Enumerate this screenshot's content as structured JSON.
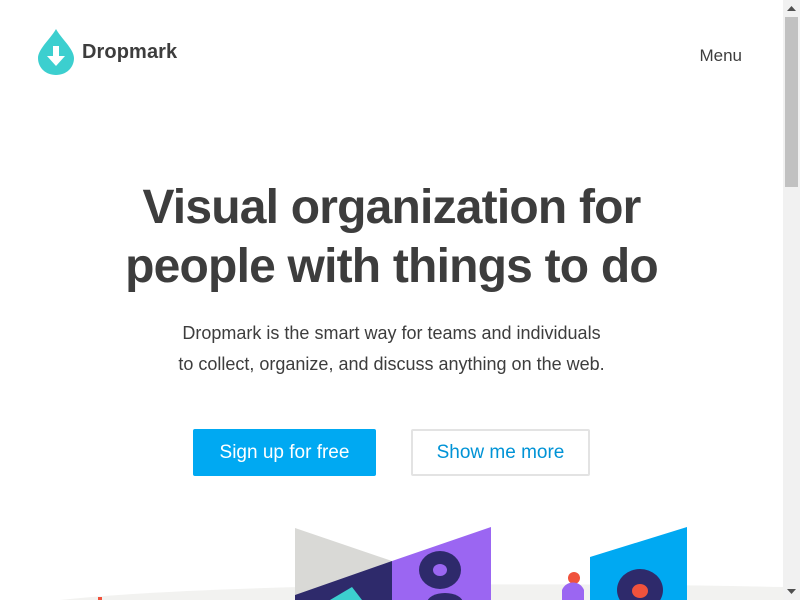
{
  "header": {
    "brand": "Dropmark",
    "menu_label": "Menu"
  },
  "hero": {
    "title_line1": "Visual organization for",
    "title_line2": "people with things to do",
    "subtitle_line1": "Dropmark is the smart way for teams and individuals",
    "subtitle_line2": "to collect, organize, and discuss anything on the web."
  },
  "actions": {
    "signup_label": "Sign up for free",
    "more_label": "Show me more"
  },
  "colors": {
    "brand_teal": "#3ccfcf",
    "primary_button": "#00a9f2",
    "secondary_text": "#0093d6",
    "heading_text": "#3d3d3d"
  },
  "icons": {
    "logo": "droplet-download-icon",
    "scroll_up": "triangle-up-icon",
    "scroll_down": "triangle-down-icon"
  }
}
